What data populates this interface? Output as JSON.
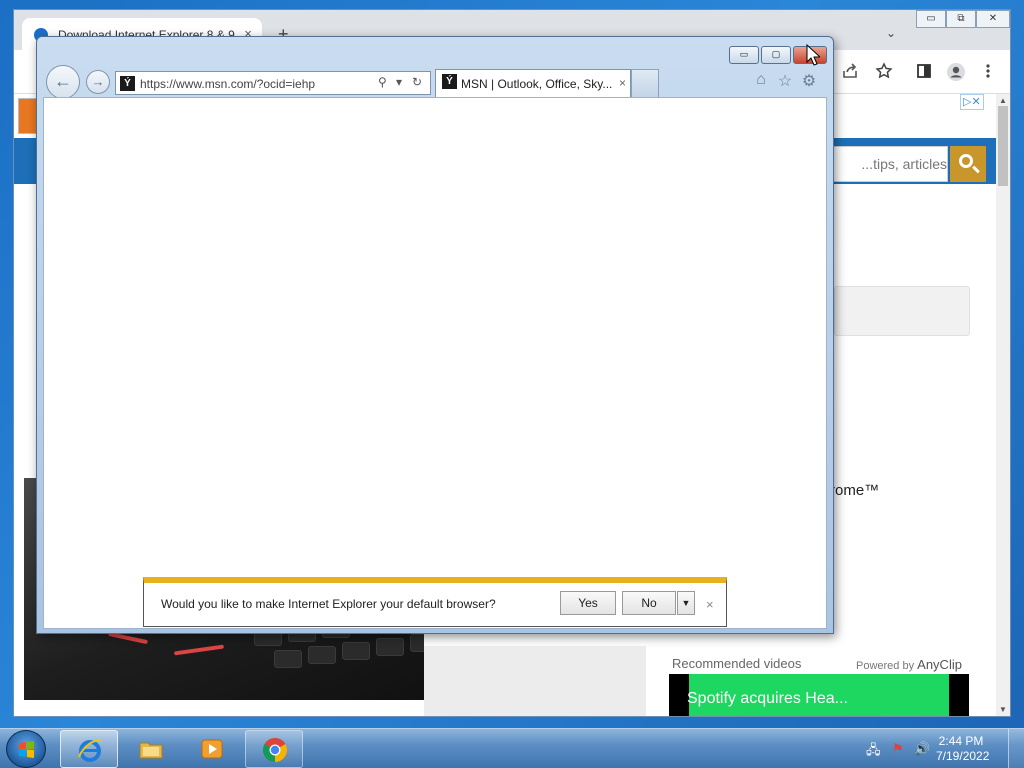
{
  "chrome": {
    "tab_title": "Download Internet Explorer 8 & 9",
    "tab_close": "×",
    "new_tab": "+",
    "tab_search": "⌄",
    "window_minimize": "▭",
    "window_restore": "⧉",
    "window_close": "✕",
    "search_placeholder": "tips, articles...",
    "ad_badge": "▷✕",
    "partial_text": "rome™",
    "recommended_videos": "Recommended videos",
    "powered_by": "Powered by",
    "powered_by_brand": "AnyClip",
    "video_title": "Spotify acquires Hea...",
    "menu_icon": "☰"
  },
  "ie": {
    "address_url": "https://www.msn.com/?ocid=iehp",
    "search_icon": "⚲",
    "dropdown_icon": "▾",
    "refresh_icon": "↻",
    "tab_title": "MSN | Outlook, Office, Sky...",
    "tab_close": "×",
    "minimize": "▭",
    "maximize": "▢",
    "close": "✕",
    "back_glyph": "←",
    "forward_glyph": "→",
    "favicon_glyph": "Ý",
    "home_glyph": "⌂",
    "favorites_glyph": "☆",
    "tools_glyph": "⚙"
  },
  "notification": {
    "message": "Would you like to make Internet Explorer your default browser?",
    "yes_label": "Yes",
    "no_label": "No",
    "dropdown": "▼",
    "close": "×"
  },
  "taskbar": {
    "time": "2:44 PM",
    "date": "7/19/2022",
    "tray_network": "🖧",
    "tray_flag": "⚑",
    "tray_volume": "🔊"
  },
  "colors": {
    "notification_accent": "#e8b11e",
    "taskbar": "#5d8fc4",
    "spotify_green": "#1ed760",
    "site_nav_blue": "#1d6fb8",
    "search_button_gold": "#c8962a"
  }
}
